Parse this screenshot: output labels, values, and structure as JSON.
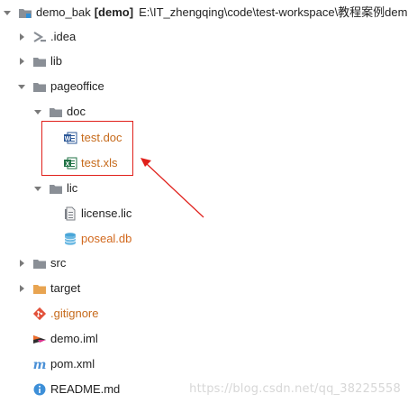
{
  "root": {
    "name": "demo_bak",
    "module": "[demo]",
    "path": "E:\\IT_zhengqing\\code\\test-workspace\\教程案例dem"
  },
  "nodes": {
    "idea": ".idea",
    "lib": "lib",
    "pageoffice": "pageoffice",
    "doc": "doc",
    "test_doc": "test.doc",
    "test_xls": "test.xls",
    "lic": "lic",
    "license_lic": "license.lic",
    "poseal_db": "poseal.db",
    "src": "src",
    "target": "target",
    "gitignore": ".gitignore",
    "demo_iml": "demo.iml",
    "pom_xml": "pom.xml",
    "readme": "README.md"
  },
  "watermark": "https://blog.csdn.net/qq_38225558",
  "colors": {
    "folder": "#8a8f96",
    "highlight": "#e0201b",
    "orange_text": "#c66a1b",
    "target_folder": "#e8a451"
  }
}
